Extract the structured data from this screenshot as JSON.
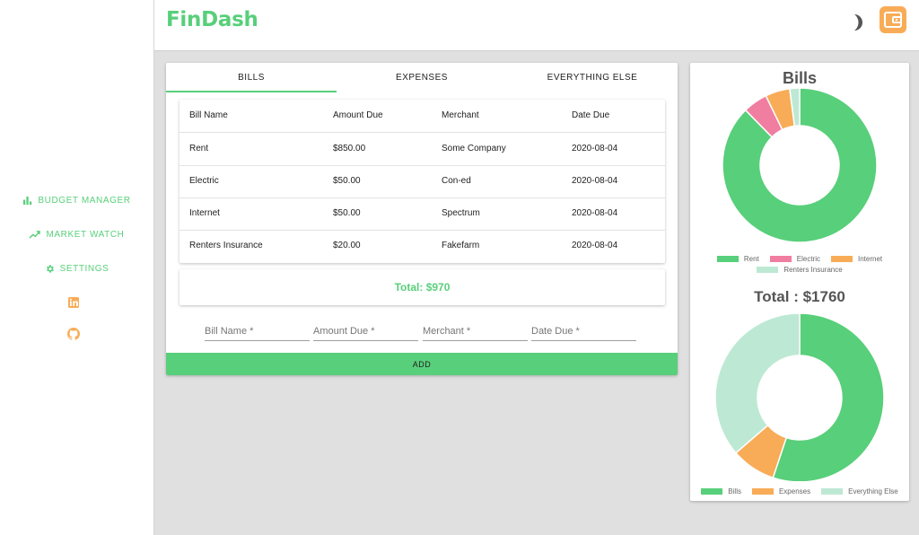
{
  "app": {
    "title": "FinDash"
  },
  "sidebar": {
    "items": [
      {
        "label": "BUDGET MANAGER",
        "icon": "bar-chart-icon"
      },
      {
        "label": "MARKET WATCH",
        "icon": "trending-up-icon"
      },
      {
        "label": "SETTINGS",
        "icon": "gear-icon"
      }
    ],
    "social": [
      "linkedin-icon",
      "github-icon"
    ]
  },
  "header": {
    "theme_icon": "moon-icon",
    "wallet_icon": "wallet-icon"
  },
  "tabs": [
    {
      "label": "BILLS",
      "active": true
    },
    {
      "label": "EXPENSES",
      "active": false
    },
    {
      "label": "EVERYTHING ELSE",
      "active": false
    }
  ],
  "table": {
    "columns": [
      "Bill Name",
      "Amount Due",
      "Merchant",
      "Date Due"
    ],
    "rows": [
      [
        "Rent",
        "$850.00",
        "Some Company",
        "2020-08-04"
      ],
      [
        "Electric",
        "$50.00",
        "Con-ed",
        "2020-08-04"
      ],
      [
        "Internet",
        "$50.00",
        "Spectrum",
        "2020-08-04"
      ],
      [
        "Renters Insurance",
        "$20.00",
        "Fakefarm",
        "2020-08-04"
      ]
    ]
  },
  "total_label": "Total: $970",
  "form": {
    "bill_name_placeholder": "Bill Name *",
    "amount_placeholder": "Amount Due *",
    "merchant_placeholder": "Merchant *",
    "date_placeholder": "Date Due *",
    "add_label": "ADD"
  },
  "colors": {
    "green": "#58cf7a",
    "pink": "#ef7ea0",
    "orange": "#f8ac58",
    "mint": "#bde9d4"
  },
  "chart_data": [
    {
      "type": "pie",
      "title": "Bills",
      "categories": [
        "Rent",
        "Electric",
        "Internet",
        "Renters Insurance"
      ],
      "values": [
        850,
        50,
        50,
        20
      ],
      "colors": [
        "#58cf7a",
        "#ef7ea0",
        "#f8ac58",
        "#bde9d4"
      ],
      "legend": "bottom"
    },
    {
      "type": "pie",
      "title": "Total : $1760",
      "categories": [
        "Bills",
        "Expenses",
        "Everything Else"
      ],
      "values": [
        970,
        150,
        640
      ],
      "colors": [
        "#58cf7a",
        "#f8ac58",
        "#bde9d4"
      ],
      "legend": "bottom"
    }
  ]
}
